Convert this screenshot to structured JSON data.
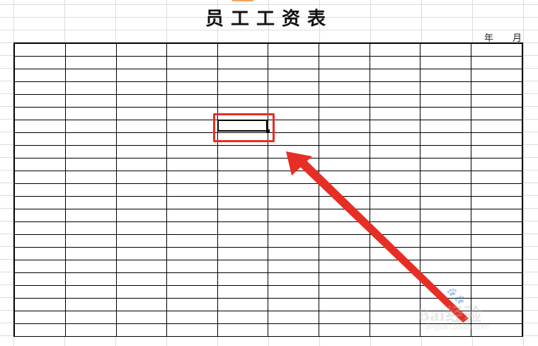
{
  "sheet": {
    "title": "员工工资表",
    "year_label": "年",
    "month_label": "月"
  },
  "table": {
    "rows": 23,
    "columns": 10,
    "selected_cell": {
      "row": 7,
      "column": 5
    }
  },
  "annotation": {
    "highlight_color": "#e62e24"
  },
  "watermark": {
    "text": "Bai经验",
    "url": "jingyan.baidu.com"
  }
}
